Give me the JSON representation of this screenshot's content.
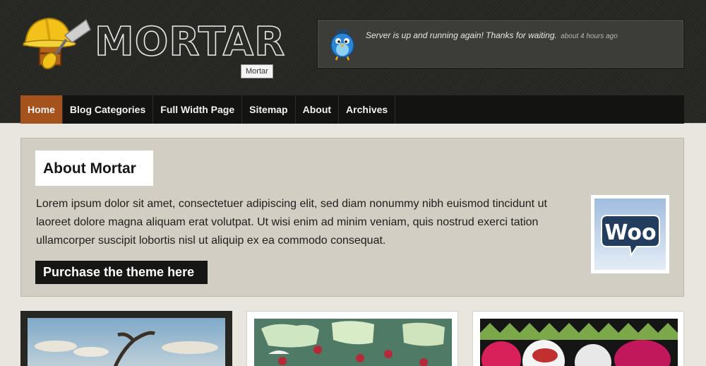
{
  "site": {
    "logo_text": "MORTAR",
    "tooltip": "Mortar"
  },
  "tweet": {
    "text": "Server is up and running again! Thanks for waiting.",
    "time": "about 4 hours ago"
  },
  "nav": {
    "items": [
      {
        "label": "Home",
        "active": true
      },
      {
        "label": "Blog Categories",
        "active": false
      },
      {
        "label": "Full Width Page",
        "active": false
      },
      {
        "label": "Sitemap",
        "active": false
      },
      {
        "label": "About",
        "active": false
      },
      {
        "label": "Archives",
        "active": false
      }
    ]
  },
  "about": {
    "title": "About Mortar",
    "text": "Lorem ipsum dolor sit amet, consectetuer adipiscing elit, sed diam nonummy nibh euismod tincidunt ut laoreet dolore magna aliquam erat volutpat. Ut wisi enim ad minim veniam, quis nostrud exerci tation ullamcorper suscipit lobortis nisl ut aliquip ex ea commodo consequat.",
    "button_label": "Purchase the theme here",
    "badge_text": "Woo"
  },
  "colors": {
    "nav_active": "#a6521c",
    "header_bg": "#262623",
    "about_bg": "#d3cec3"
  }
}
